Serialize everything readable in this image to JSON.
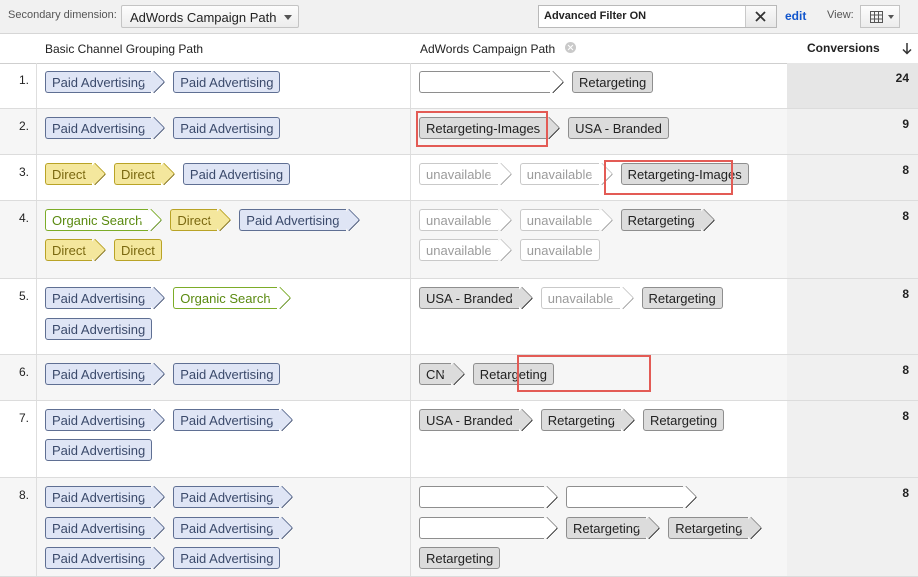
{
  "toolbar": {
    "secondary_label": "Secondary dimension:",
    "secondary_value": "AdWords Campaign Path",
    "filter_text": "Advanced Filter ON",
    "edit_label": "edit",
    "view_label": "View:"
  },
  "columns": {
    "channel": "Basic Channel Grouping Path",
    "campaign": "AdWords Campaign Path",
    "conversions": "Conversions"
  },
  "rows": [
    {
      "num": "1.",
      "conv": "24",
      "channel": [
        [
          "Paid Advertising",
          "Paid Advertising"
        ]
      ],
      "campaign": [
        [
          "",
          "Retargeting"
        ]
      ]
    },
    {
      "num": "2.",
      "conv": "9",
      "channel": [
        [
          "Paid Advertising",
          "Paid Advertising"
        ]
      ],
      "campaign": [
        [
          "Retargeting-Images",
          "USA - Branded"
        ]
      ]
    },
    {
      "num": "3.",
      "conv": "8",
      "channel": [
        [
          "Direct",
          "Direct",
          "Paid Advertising"
        ]
      ],
      "campaign": [
        [
          "unavailable",
          "unavailable",
          "Retargeting-Images"
        ]
      ]
    },
    {
      "num": "4.",
      "conv": "8",
      "channel": [
        [
          "Organic Search",
          "Direct",
          "Paid Advertising"
        ],
        [
          "Direct",
          "Direct"
        ]
      ],
      "campaign": [
        [
          "unavailable",
          "unavailable",
          "Retargeting"
        ],
        [
          "unavailable",
          "unavailable"
        ]
      ]
    },
    {
      "num": "5.",
      "conv": "8",
      "channel": [
        [
          "Paid Advertising",
          "Organic Search"
        ],
        [
          "Paid Advertising"
        ]
      ],
      "campaign": [
        [
          "USA - Branded",
          "unavailable",
          "Retargeting"
        ]
      ]
    },
    {
      "num": "6.",
      "conv": "8",
      "channel": [
        [
          "Paid Advertising",
          "Paid Advertising"
        ]
      ],
      "campaign": [
        [
          "CN",
          "Retargeting"
        ]
      ]
    },
    {
      "num": "7.",
      "conv": "8",
      "channel": [
        [
          "Paid Advertising",
          "Paid Advertising"
        ],
        [
          "Paid Advertising"
        ]
      ],
      "campaign": [
        [
          "USA - Branded",
          "Retargeting",
          "Retargeting"
        ]
      ]
    },
    {
      "num": "8.",
      "conv": "8",
      "channel": [
        [
          "Paid Advertising",
          "Paid Advertising"
        ],
        [
          "Paid Advertising",
          "Paid Advertising"
        ],
        [
          "Paid Advertising",
          "Paid Advertising"
        ]
      ],
      "campaign": [
        [
          "",
          ""
        ],
        [
          "",
          "Retargeting",
          "Retargeting"
        ],
        [
          "Retargeting"
        ]
      ]
    }
  ],
  "colors": {
    "highlight": "#e35b55",
    "paid": "#dfe5f5",
    "direct": "#f4e79d",
    "organic": "#7cac28",
    "campaign": "#dcdcdc"
  }
}
